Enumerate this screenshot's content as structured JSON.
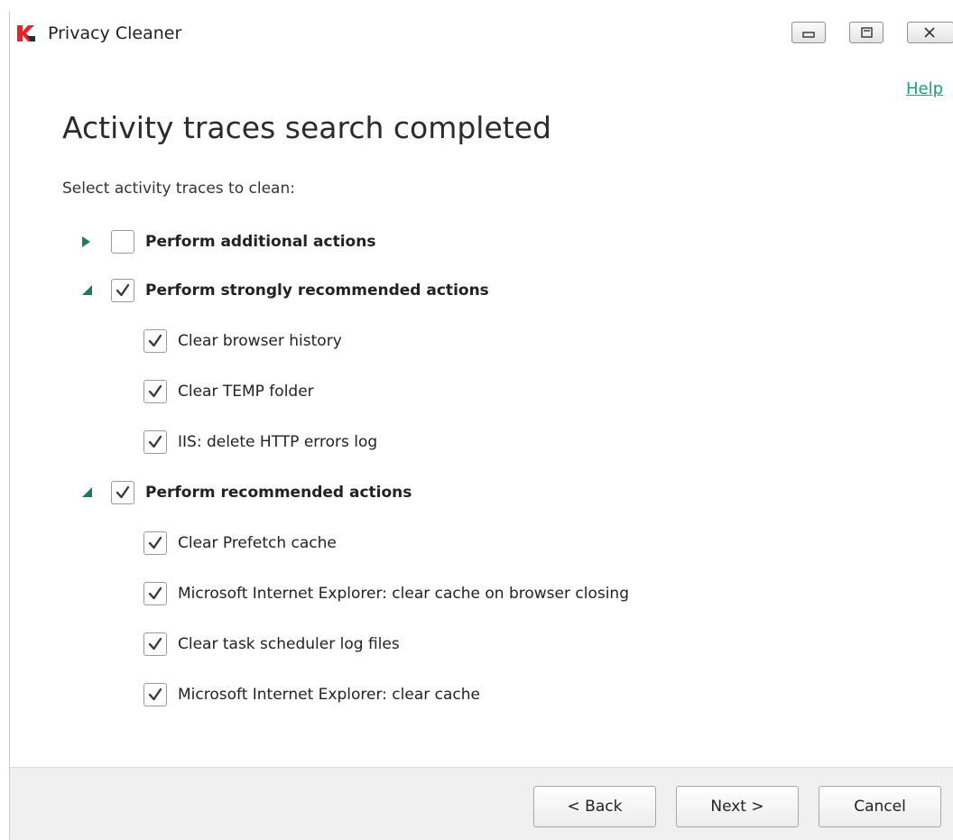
{
  "window": {
    "title": "Privacy Cleaner",
    "help_label": "Help"
  },
  "page": {
    "title": "Activity traces search completed",
    "subtitle": "Select activity traces to clean:"
  },
  "groups": [
    {
      "label": "Perform additional actions",
      "expanded": false,
      "checked": false,
      "items": []
    },
    {
      "label": "Perform strongly recommended actions",
      "expanded": true,
      "checked": true,
      "items": [
        {
          "label": "Clear browser history",
          "checked": true
        },
        {
          "label": "Clear TEMP folder",
          "checked": true
        },
        {
          "label": "IIS: delete HTTP errors log",
          "checked": true
        }
      ]
    },
    {
      "label": "Perform recommended actions",
      "expanded": true,
      "checked": true,
      "items": [
        {
          "label": "Clear Prefetch cache",
          "checked": true
        },
        {
          "label": "Microsoft Internet Explorer: clear cache on browser closing",
          "checked": true
        },
        {
          "label": "Clear task scheduler log files",
          "checked": true
        },
        {
          "label": "Microsoft Internet Explorer: clear cache",
          "checked": true
        }
      ]
    }
  ],
  "footer": {
    "back_label": "< Back",
    "next_label": "Next >",
    "cancel_label": "Cancel"
  },
  "colors": {
    "accent": "#1a9e7d",
    "expander": "#1c7a63",
    "logo_red": "#e3262b"
  },
  "icons": {
    "logo": "kaspersky-k-icon",
    "minimize": "minimize-icon",
    "maximize": "maximize-icon",
    "close": "close-icon",
    "expand": "triangle-right-icon",
    "collapse": "triangle-down-icon",
    "check": "checkmark-icon"
  }
}
